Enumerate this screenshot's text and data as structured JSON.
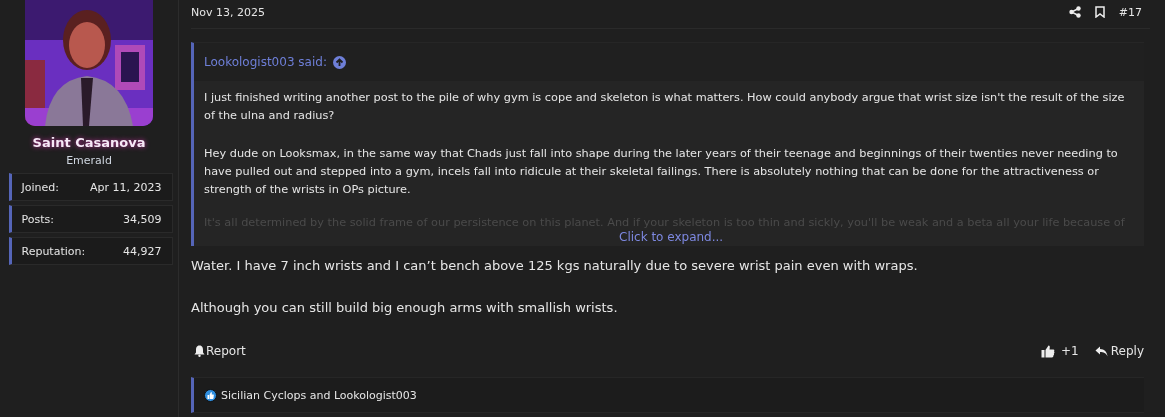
{
  "user": {
    "name": "Saint Casanova",
    "title": "Emerald",
    "stats": [
      {
        "label": "Joined:",
        "value": "Apr 11, 2023"
      },
      {
        "label": "Posts:",
        "value": "34,509"
      },
      {
        "label": "Reputation:",
        "value": "44,927"
      }
    ]
  },
  "post": {
    "date": "Nov 13, 2025",
    "number": "#17",
    "quote": {
      "author": "Lookologist003 said:",
      "paragraphs": [
        "I just finished writing another post to the pile of why gym is cope and skeleton is what matters. How could anybody argue that wrist size isn't the result of the size of the ulna and radius?",
        "Hey dude on Looksmax, in the same way that Chads just fall into shape during the later years of their teenage and beginnings of their twenties never needing to have pulled out and stepped into a gym, incels fall into ridicule at their skeletal failings. There is absolutely nothing that can be done for the attractiveness or strength of the wrists in OPs picture."
      ],
      "faded_line": "It's all determined by the solid frame of our persistence on this planet. And if your skeleton is too thin and sickly, you'll be weak and a beta all your life because of",
      "expand": "Click to expand..."
    },
    "body": [
      "Water. I have 7 inch wrists and I can’t bench above 125 kgs naturally due to severe wrist pain even with wraps.",
      "Although you can still build big enough arms with smallish wrists."
    ],
    "report": "Report",
    "like_count": "+1",
    "reply": "Reply",
    "reactions": "Sicilian Cyclops and Lookologist003"
  }
}
